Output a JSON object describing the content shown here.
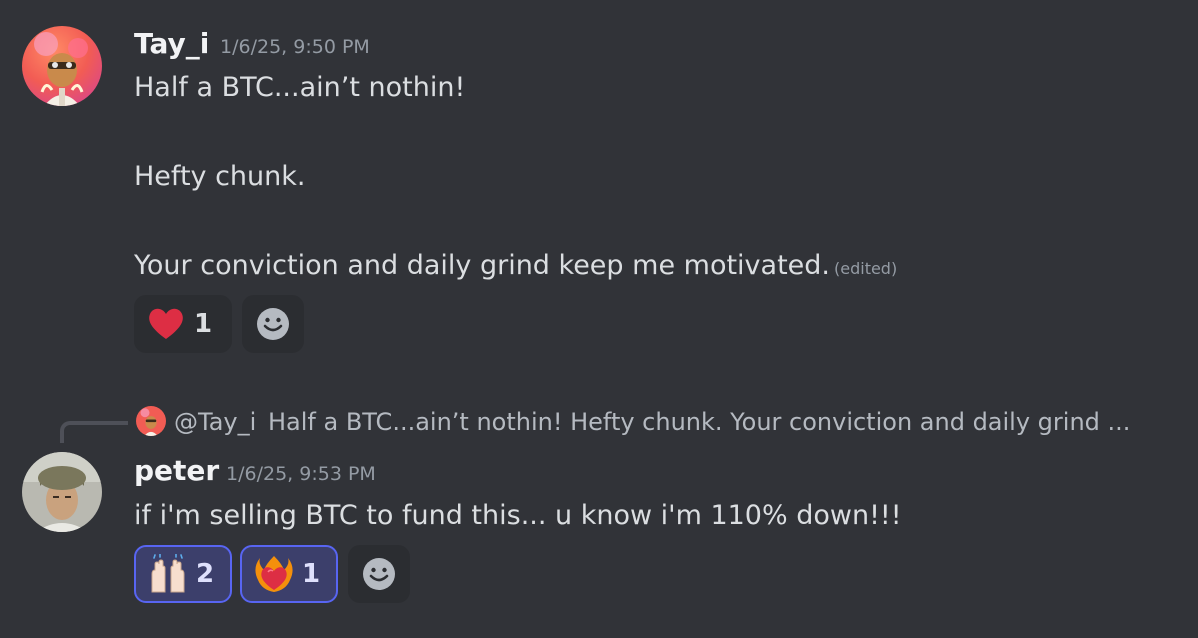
{
  "messages": [
    {
      "username": "Tay_i",
      "timestamp": "1/6/25, 9:50 PM",
      "lines": [
        "Half a BTC...ain’t nothin!",
        "Hefty chunk.",
        "Your conviction and daily grind keep me motivated."
      ],
      "edited_label": "(edited)",
      "reactions": [
        {
          "emoji": "heart-emoji",
          "count": "1",
          "reacted_by_me": false
        }
      ]
    },
    {
      "username": "peter",
      "timestamp": "1/6/25, 9:53 PM",
      "reply": {
        "mention": "@Tay_i",
        "preview": "Half a BTC...ain’t nothin!  Hefty chunk.  Your conviction and daily grind ..."
      },
      "lines": [
        "if i'm selling BTC to fund this... u know i'm 110% down!!!"
      ],
      "reactions": [
        {
          "emoji": "raising-hands-emoji",
          "count": "2",
          "reacted_by_me": true
        },
        {
          "emoji": "heart-on-fire-emoji",
          "count": "1",
          "reacted_by_me": true
        }
      ]
    }
  ],
  "colors": {
    "background": "#313338",
    "reaction_bg": "#2b2d31",
    "reaction_active_border": "#5865f2",
    "timestamp": "#949ba4"
  }
}
